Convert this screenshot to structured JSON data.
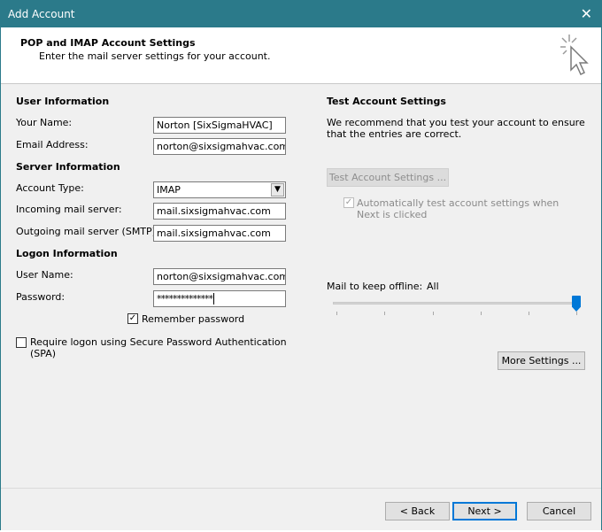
{
  "window": {
    "title": "Add Account",
    "close_glyph": "✕"
  },
  "header": {
    "title": "POP and IMAP Account Settings",
    "subtitle": "Enter the mail server settings for your account."
  },
  "user_info": {
    "section": "User Information",
    "name_label": "Your Name:",
    "name_value": "Norton [SixSigmaHVAC]",
    "email_label": "Email Address:",
    "email_value": "norton@sixsigmahvac.com"
  },
  "server_info": {
    "section": "Server Information",
    "account_type_label": "Account Type:",
    "account_type_value": "IMAP",
    "incoming_label": "Incoming mail server:",
    "incoming_value": "mail.sixsigmahvac.com",
    "outgoing_label": "Outgoing mail server (SMTP):",
    "outgoing_value": "mail.sixsigmahvac.com"
  },
  "logon_info": {
    "section": "Logon Information",
    "username_label": "User Name:",
    "username_value": "norton@sixsigmahvac.com",
    "password_label": "Password:",
    "password_value": "**************",
    "remember_label": "Remember password",
    "remember_checked": true,
    "spa_label": "Require logon using Secure Password Authentication (SPA)",
    "spa_checked": false
  },
  "test": {
    "section": "Test Account Settings",
    "description": "We recommend that you test your account to ensure that the entries are correct.",
    "button": "Test Account Settings ...",
    "auto_test_label": "Automatically test account settings when Next is clicked",
    "auto_test_checked": true
  },
  "offline": {
    "label": "Mail to keep offline:",
    "value": "All",
    "slider_level": 1.0
  },
  "buttons": {
    "more_settings": "More Settings ...",
    "back": "< Back",
    "next": "Next >",
    "cancel": "Cancel"
  },
  "colors": {
    "titlebar": "#2b7a8a",
    "accent": "#0078d7"
  },
  "icons": {
    "header": "mouse-cursor-sparkle-icon",
    "check": "checkmark-icon",
    "dropdown": "chevron-down-icon"
  }
}
